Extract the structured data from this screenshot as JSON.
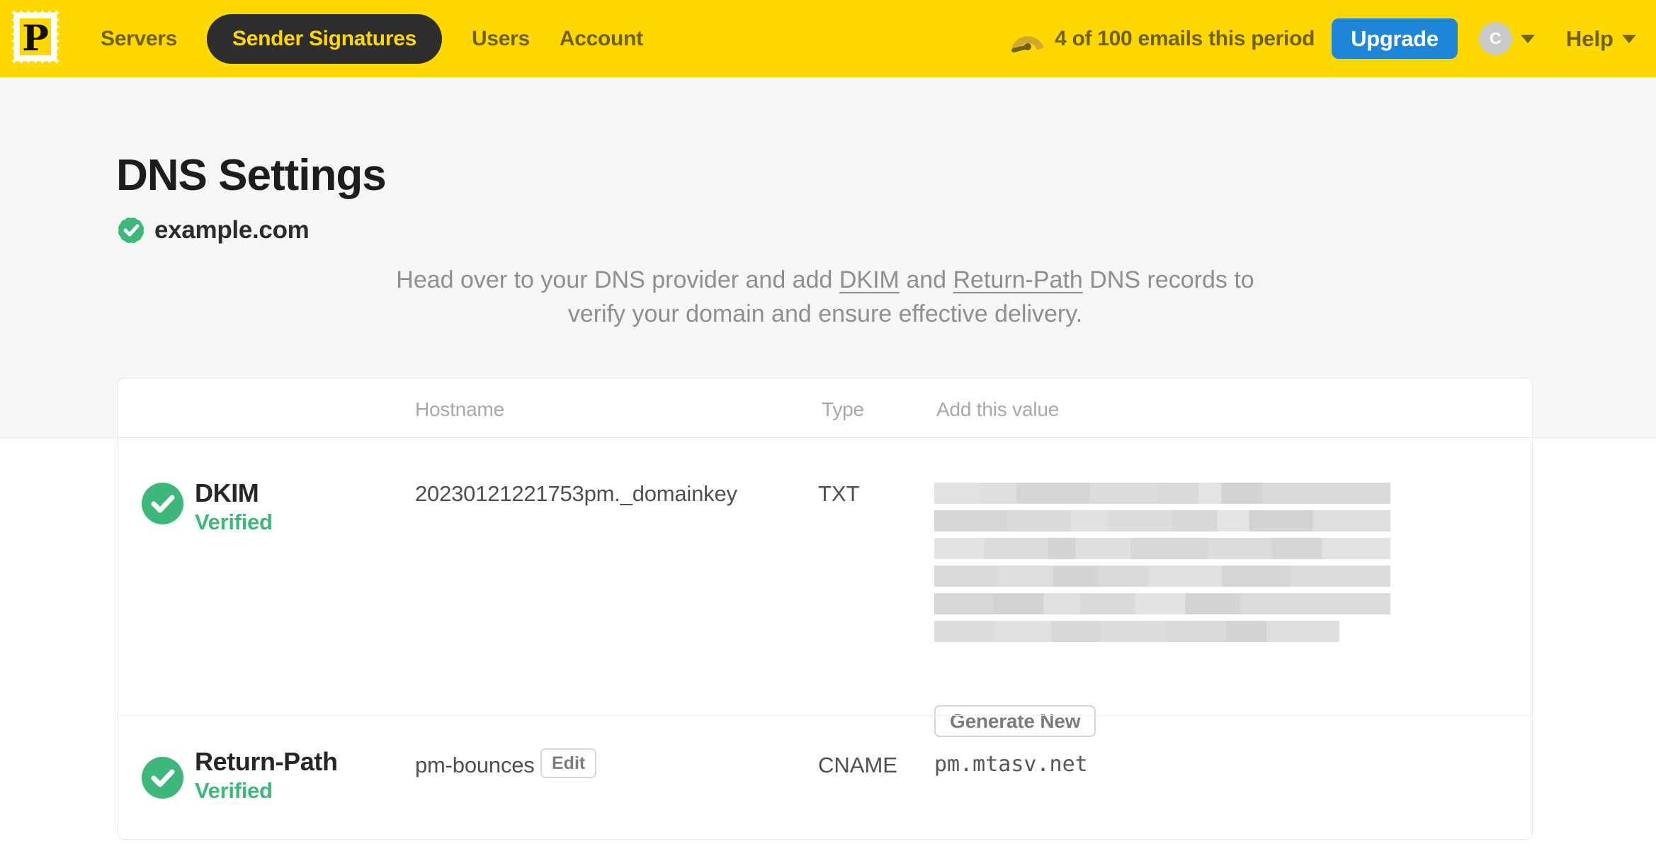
{
  "header": {
    "brand_letter": "P",
    "nav": [
      {
        "label": "Servers",
        "active": false
      },
      {
        "label": "Sender Signatures",
        "active": true
      },
      {
        "label": "Users",
        "active": false
      },
      {
        "label": "Account",
        "active": false
      }
    ],
    "usage_text": "4 of 100 emails this period",
    "upgrade_label": "Upgrade",
    "avatar_initial": "C",
    "help_label": "Help"
  },
  "page": {
    "title": "DNS Settings",
    "domain": "example.com",
    "domain_verified": true,
    "intro": {
      "text_before_dkim": "Head over to your DNS provider and add ",
      "dkim_link": "DKIM",
      "text_between": " and ",
      "return_path_link": "Return-Path",
      "text_after_line1": " DNS records to",
      "line2": "verify your domain and ensure effective delivery."
    }
  },
  "table": {
    "columns": [
      "Hostname",
      "Type",
      "Add this value"
    ],
    "rows": [
      {
        "name": "DKIM",
        "status": "Verified",
        "hostname": "20230121221753pm._domainkey",
        "type": "TXT",
        "value_redacted": true,
        "redacted_line_widths": [
          644,
          644,
          644,
          644,
          644,
          572
        ],
        "action_label": "Generate New"
      },
      {
        "name": "Return-Path",
        "status": "Verified",
        "hostname": "pm-bounces",
        "edit_label": "Edit",
        "type": "CNAME",
        "value": "pm.mtasv.net"
      }
    ]
  },
  "colors": {
    "brand_yellow": "#ffd800",
    "nav_text_olive": "#6d6215",
    "active_pill_bg": "#2e2e2e",
    "upgrade_blue": "#1d86d8",
    "verified_green": "#3eb87a",
    "title_text": "#1d1d1d",
    "muted_text": "#8f8f8f"
  }
}
